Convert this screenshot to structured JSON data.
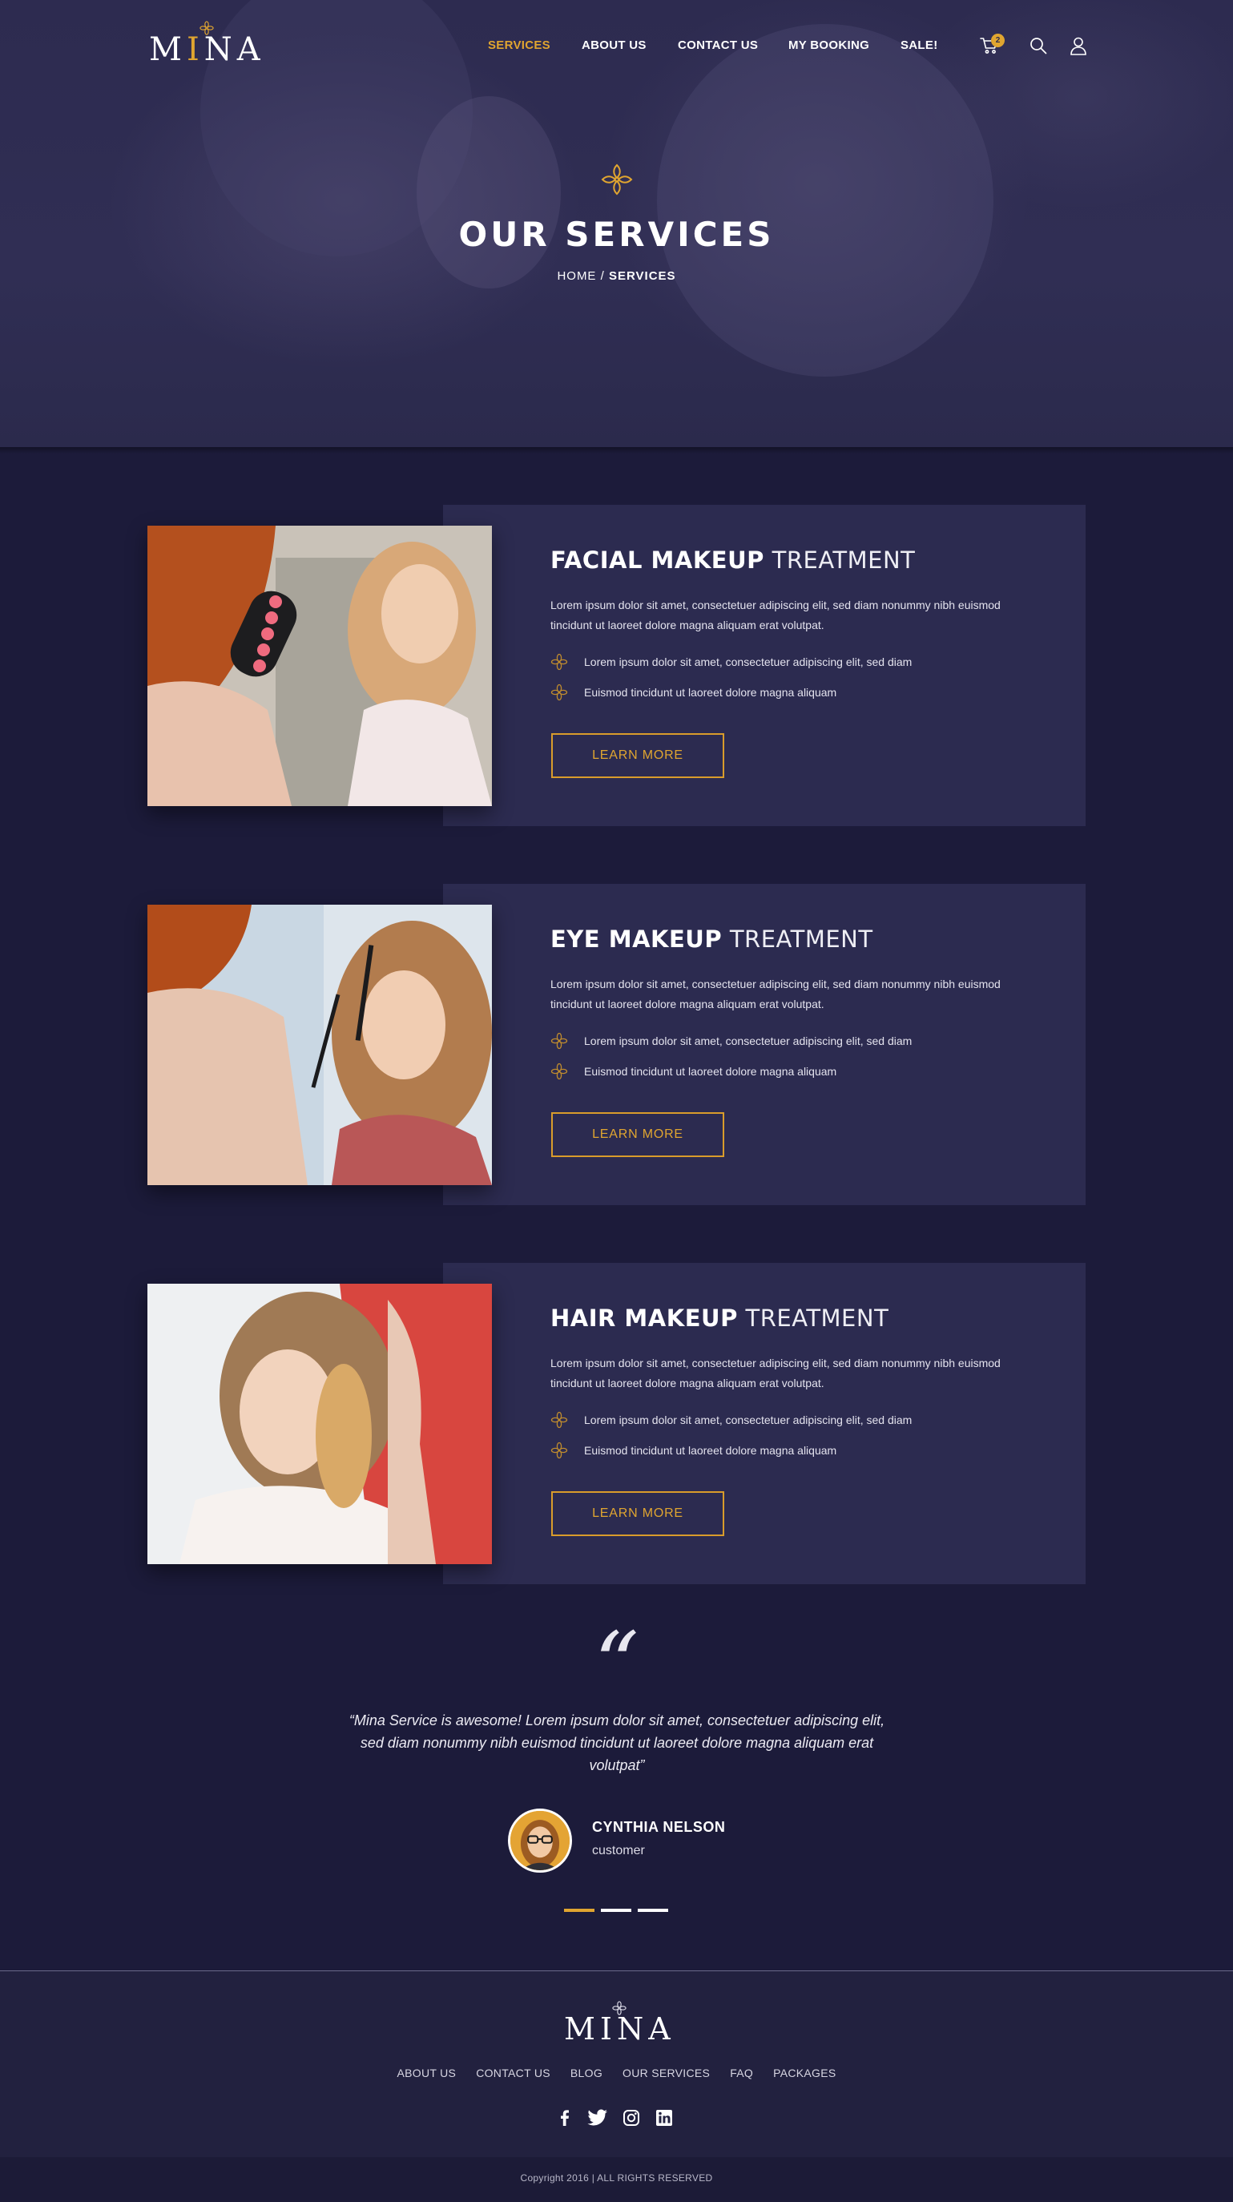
{
  "brand": {
    "logo_text_before": "M",
    "logo_text_accent": "I",
    "logo_text_after": "NA"
  },
  "nav": {
    "items": [
      {
        "label": "SERVICES",
        "active": true
      },
      {
        "label": "ABOUT US",
        "active": false
      },
      {
        "label": "CONTACT US",
        "active": false
      },
      {
        "label": "MY BOOKING",
        "active": false
      },
      {
        "label": "SALE!",
        "active": false
      }
    ],
    "cart_count": "2"
  },
  "hero": {
    "title": "OUR SERVICES",
    "breadcrumb_home": "HOME",
    "breadcrumb_separator": "/",
    "breadcrumb_current": "SERVICES"
  },
  "services": [
    {
      "title_bold": "FACIAL MAKEUP",
      "title_light": "TREATMENT",
      "description": "Lorem ipsum dolor sit amet, consectetuer adipiscing elit, sed diam nonummy nibh euismod tincidunt ut laoreet dolore magna aliquam erat volutpat.",
      "bullets": [
        "Lorem ipsum dolor sit amet, consectetuer adipiscing elit, sed diam",
        "Euismod tincidunt ut laoreet dolore magna aliquam"
      ],
      "button": "LEARN MORE"
    },
    {
      "title_bold": "EYE MAKEUP",
      "title_light": "TREATMENT",
      "description": "Lorem ipsum dolor sit amet, consectetuer adipiscing elit, sed diam nonummy nibh euismod tincidunt ut laoreet dolore magna aliquam erat volutpat.",
      "bullets": [
        "Lorem ipsum dolor sit amet, consectetuer adipiscing elit, sed diam",
        "Euismod tincidunt ut laoreet dolore magna aliquam"
      ],
      "button": "LEARN MORE"
    },
    {
      "title_bold": "HAIR MAKEUP",
      "title_light": "TREATMENT",
      "description": "Lorem ipsum dolor sit amet, consectetuer adipiscing elit, sed diam nonummy nibh euismod tincidunt ut laoreet dolore magna aliquam erat volutpat.",
      "bullets": [
        "Lorem ipsum dolor sit amet, consectetuer adipiscing elit, sed diam",
        "Euismod tincidunt ut laoreet dolore magna aliquam"
      ],
      "button": "LEARN MORE"
    }
  ],
  "testimonial": {
    "quote_mark": "“",
    "text": "“Mina Service is awesome! Lorem ipsum dolor sit amet, consectetuer adipiscing elit, sed diam nonummy nibh euismod tincidunt ut laoreet dolore magna aliquam erat volutpat”",
    "author": "CYNTHIA NELSON",
    "role": "customer",
    "slide_count": 3,
    "active_slide": 1
  },
  "footer": {
    "links": [
      "ABOUT US",
      "CONTACT US",
      "BLOG",
      "OUR SERVICES",
      "FAQ",
      "PACKAGES"
    ],
    "social_icons": [
      "facebook-icon",
      "twitter-icon",
      "instagram-icon",
      "linkedin-icon"
    ],
    "copyright": "Copyright 2016 | ALL RIGHTS RESERVED"
  },
  "colors": {
    "accent": "#e0a530",
    "background": "#1c1b3a",
    "panel": "#2c2b50",
    "hero": "#2d2b50"
  }
}
